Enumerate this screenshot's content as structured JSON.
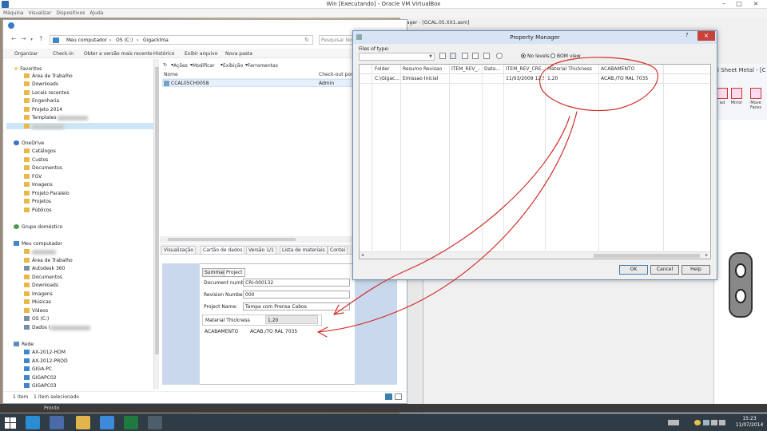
{
  "vbox": {
    "title": "Win [Executando] - Oracle VM VirtualBox",
    "menu": [
      "Máquina",
      "Visualizar",
      "Dispositivos",
      "Ajuda"
    ],
    "minimize": "–",
    "maximize": "□",
    "close": "×"
  },
  "bg_app": {
    "title": "nager - [GCAL.05.XX1.asm]",
    "ribbon_label": "l Sheet Metal - [C",
    "ribbon_buttons": [
      "ed",
      "Mirror",
      "Move Faces"
    ]
  },
  "explorer": {
    "address": [
      "Meu computador",
      "OS (C:)",
      "Gigacklma"
    ],
    "search_placeholder": "Pesquisar No",
    "commands": [
      "Organizar",
      "Check-in",
      "Obter a versão mais recente",
      "Histórico",
      "Exibir arquivo",
      "Nova pasta"
    ],
    "nav": {
      "favorites_header": "Favoritos",
      "favorites": [
        "Área de Trabalho",
        "Downloads",
        "Locais recentes",
        "Engenharia",
        "Projeto 2014",
        "Templates"
      ],
      "onedrive_header": "OneDrive",
      "onedrive": [
        "Catálogos",
        "Custos",
        "Documentos",
        "FGV",
        "Imagens",
        "Projeto Paralelo",
        "Projetos",
        "Públicos"
      ],
      "homegroup": "Grupo doméstico",
      "computer_header": "Meu computador",
      "computer": [
        "Área de Trabalho",
        "Autodesk 360",
        "Documentos",
        "Downloads",
        "Imagens",
        "Músicas",
        "Vídeos",
        "OS (C:)",
        "Dados ("
      ],
      "network_header": "Rede",
      "network": [
        "AX-2012-HOM",
        "AX-2012-PROD",
        "GIGA-PC",
        "GIGAPC02",
        "GIGAPC03"
      ]
    },
    "file_toolbar": [
      "Ações",
      "Modificar",
      "Exibição",
      "Ferramentas"
    ],
    "columns": [
      "Nome",
      "Check-out por"
    ],
    "file": {
      "name": "CCAL05CH0058",
      "checkout": "Admin"
    },
    "tabs": [
      "Visualização",
      "Cartão de dados",
      "Versão 1/1",
      "Lista de materiais",
      "Contei"
    ],
    "datacard": {
      "subtabs": [
        "Summary",
        "Project"
      ],
      "fields": [
        {
          "label": "Document number:",
          "value": "CRI-000132"
        },
        {
          "label": "Revision Number:",
          "value": "000"
        },
        {
          "label": "Project Name:",
          "value": "Tampa com Prensa Cabos"
        }
      ],
      "material_label": "Material Thickness",
      "material_value": "1,20",
      "acab_label": "ACABAMENTO",
      "acab_value": "ACAB./TO RAL 7035"
    },
    "status": {
      "items": "1 item",
      "selected": "1 item selecionado"
    }
  },
  "status_ready": "Pronto",
  "property_manager": {
    "title": "Property Manager",
    "help": "?",
    "close": "×",
    "files_of_type": "Files of type:",
    "radio_no_levels": "No levels",
    "radio_bom_view": "BOM view",
    "columns": [
      "Folder",
      "Resumo Revisao",
      "ITEM_REV_...",
      "Data...",
      "ITEM_REV_CRE...",
      "Material Thickness",
      "ACABAMENTO"
    ],
    "row": [
      "C:\\Gigac...",
      "Emissao Inicial",
      "",
      "",
      "11/03/2009 12:55",
      "1,20",
      "ACAB./TO RAL 7035"
    ],
    "buttons": {
      "ok": "OK",
      "cancel": "Cancel",
      "help": "Help"
    }
  },
  "clock": {
    "time": "15:23",
    "date": "11/07/2014"
  },
  "colors": {
    "annotation": "#d2302a",
    "accent": "#3c7fb1"
  }
}
